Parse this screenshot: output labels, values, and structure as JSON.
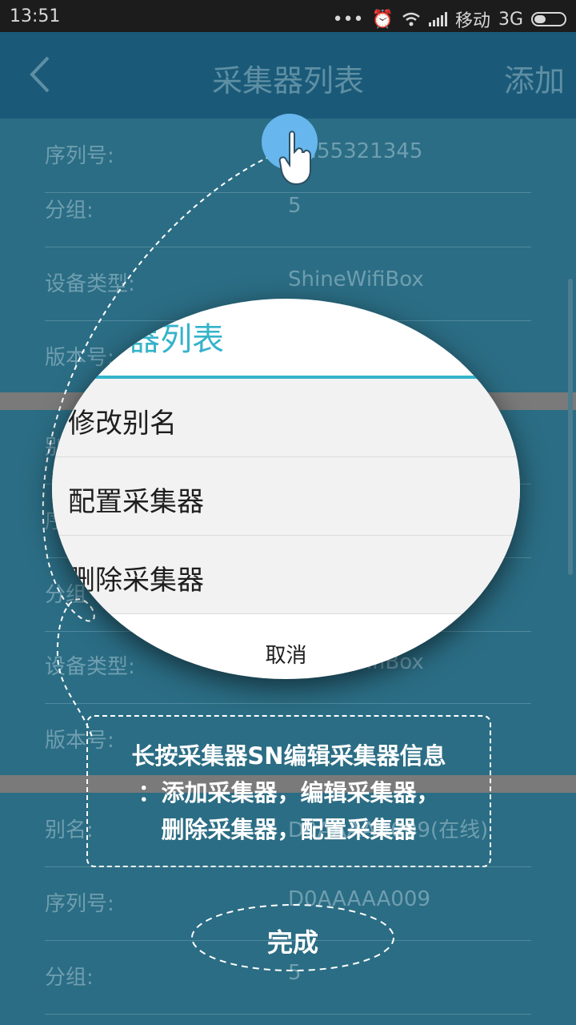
{
  "status": {
    "time": "13:51",
    "carrier": "移动",
    "network": "3G"
  },
  "nav": {
    "title": "采集器列表",
    "add": "添加"
  },
  "rows": [
    {
      "label": "序列号:",
      "value": "SH55321345"
    },
    {
      "label": "分组:",
      "value": "5"
    },
    {
      "label": "设备类型:",
      "value": "ShineWifiBox"
    },
    {
      "label": "版本号:",
      "value": ""
    },
    {
      "label": "别",
      "value": ""
    },
    {
      "label": "序",
      "value": ""
    },
    {
      "label": "分组",
      "value": ""
    },
    {
      "label": "设备类型:",
      "value": "ShineWifiBox"
    },
    {
      "label": "版本号:",
      "value": ""
    },
    {
      "label": "别名:",
      "value": "D0AAAAA009(在线)"
    },
    {
      "label": "序列号:",
      "value": "D0AAAAA009"
    },
    {
      "label": "分组:",
      "value": "5"
    }
  ],
  "dialog": {
    "title": "器列表",
    "items": [
      "修改别名",
      "配置采集器",
      "删除采集器"
    ],
    "cancel": "取消"
  },
  "hint": {
    "line1": "长按采集器SN编辑采集器信息",
    "line2": "：添加采集器，编辑采集器，",
    "line3": "删除采集器，配置采集器"
  },
  "done": "完成",
  "colors": {
    "accent": "#35b3cb",
    "header": "#1a5a78",
    "list_bg": "#2b6d84"
  }
}
